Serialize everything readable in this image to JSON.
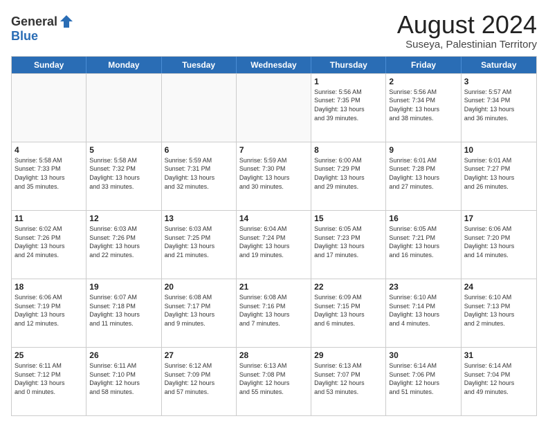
{
  "header": {
    "logo_general": "General",
    "logo_blue": "Blue",
    "main_title": "August 2024",
    "subtitle": "Suseya, Palestinian Territory"
  },
  "calendar": {
    "days_of_week": [
      "Sunday",
      "Monday",
      "Tuesday",
      "Wednesday",
      "Thursday",
      "Friday",
      "Saturday"
    ],
    "weeks": [
      [
        {
          "day": "",
          "info": ""
        },
        {
          "day": "",
          "info": ""
        },
        {
          "day": "",
          "info": ""
        },
        {
          "day": "",
          "info": ""
        },
        {
          "day": "1",
          "info": "Sunrise: 5:56 AM\nSunset: 7:35 PM\nDaylight: 13 hours\nand 39 minutes."
        },
        {
          "day": "2",
          "info": "Sunrise: 5:56 AM\nSunset: 7:34 PM\nDaylight: 13 hours\nand 38 minutes."
        },
        {
          "day": "3",
          "info": "Sunrise: 5:57 AM\nSunset: 7:34 PM\nDaylight: 13 hours\nand 36 minutes."
        }
      ],
      [
        {
          "day": "4",
          "info": "Sunrise: 5:58 AM\nSunset: 7:33 PM\nDaylight: 13 hours\nand 35 minutes."
        },
        {
          "day": "5",
          "info": "Sunrise: 5:58 AM\nSunset: 7:32 PM\nDaylight: 13 hours\nand 33 minutes."
        },
        {
          "day": "6",
          "info": "Sunrise: 5:59 AM\nSunset: 7:31 PM\nDaylight: 13 hours\nand 32 minutes."
        },
        {
          "day": "7",
          "info": "Sunrise: 5:59 AM\nSunset: 7:30 PM\nDaylight: 13 hours\nand 30 minutes."
        },
        {
          "day": "8",
          "info": "Sunrise: 6:00 AM\nSunset: 7:29 PM\nDaylight: 13 hours\nand 29 minutes."
        },
        {
          "day": "9",
          "info": "Sunrise: 6:01 AM\nSunset: 7:28 PM\nDaylight: 13 hours\nand 27 minutes."
        },
        {
          "day": "10",
          "info": "Sunrise: 6:01 AM\nSunset: 7:27 PM\nDaylight: 13 hours\nand 26 minutes."
        }
      ],
      [
        {
          "day": "11",
          "info": "Sunrise: 6:02 AM\nSunset: 7:26 PM\nDaylight: 13 hours\nand 24 minutes."
        },
        {
          "day": "12",
          "info": "Sunrise: 6:03 AM\nSunset: 7:26 PM\nDaylight: 13 hours\nand 22 minutes."
        },
        {
          "day": "13",
          "info": "Sunrise: 6:03 AM\nSunset: 7:25 PM\nDaylight: 13 hours\nand 21 minutes."
        },
        {
          "day": "14",
          "info": "Sunrise: 6:04 AM\nSunset: 7:24 PM\nDaylight: 13 hours\nand 19 minutes."
        },
        {
          "day": "15",
          "info": "Sunrise: 6:05 AM\nSunset: 7:23 PM\nDaylight: 13 hours\nand 17 minutes."
        },
        {
          "day": "16",
          "info": "Sunrise: 6:05 AM\nSunset: 7:21 PM\nDaylight: 13 hours\nand 16 minutes."
        },
        {
          "day": "17",
          "info": "Sunrise: 6:06 AM\nSunset: 7:20 PM\nDaylight: 13 hours\nand 14 minutes."
        }
      ],
      [
        {
          "day": "18",
          "info": "Sunrise: 6:06 AM\nSunset: 7:19 PM\nDaylight: 13 hours\nand 12 minutes."
        },
        {
          "day": "19",
          "info": "Sunrise: 6:07 AM\nSunset: 7:18 PM\nDaylight: 13 hours\nand 11 minutes."
        },
        {
          "day": "20",
          "info": "Sunrise: 6:08 AM\nSunset: 7:17 PM\nDaylight: 13 hours\nand 9 minutes."
        },
        {
          "day": "21",
          "info": "Sunrise: 6:08 AM\nSunset: 7:16 PM\nDaylight: 13 hours\nand 7 minutes."
        },
        {
          "day": "22",
          "info": "Sunrise: 6:09 AM\nSunset: 7:15 PM\nDaylight: 13 hours\nand 6 minutes."
        },
        {
          "day": "23",
          "info": "Sunrise: 6:10 AM\nSunset: 7:14 PM\nDaylight: 13 hours\nand 4 minutes."
        },
        {
          "day": "24",
          "info": "Sunrise: 6:10 AM\nSunset: 7:13 PM\nDaylight: 13 hours\nand 2 minutes."
        }
      ],
      [
        {
          "day": "25",
          "info": "Sunrise: 6:11 AM\nSunset: 7:12 PM\nDaylight: 13 hours\nand 0 minutes."
        },
        {
          "day": "26",
          "info": "Sunrise: 6:11 AM\nSunset: 7:10 PM\nDaylight: 12 hours\nand 58 minutes."
        },
        {
          "day": "27",
          "info": "Sunrise: 6:12 AM\nSunset: 7:09 PM\nDaylight: 12 hours\nand 57 minutes."
        },
        {
          "day": "28",
          "info": "Sunrise: 6:13 AM\nSunset: 7:08 PM\nDaylight: 12 hours\nand 55 minutes."
        },
        {
          "day": "29",
          "info": "Sunrise: 6:13 AM\nSunset: 7:07 PM\nDaylight: 12 hours\nand 53 minutes."
        },
        {
          "day": "30",
          "info": "Sunrise: 6:14 AM\nSunset: 7:06 PM\nDaylight: 12 hours\nand 51 minutes."
        },
        {
          "day": "31",
          "info": "Sunrise: 6:14 AM\nSunset: 7:04 PM\nDaylight: 12 hours\nand 49 minutes."
        }
      ]
    ]
  }
}
